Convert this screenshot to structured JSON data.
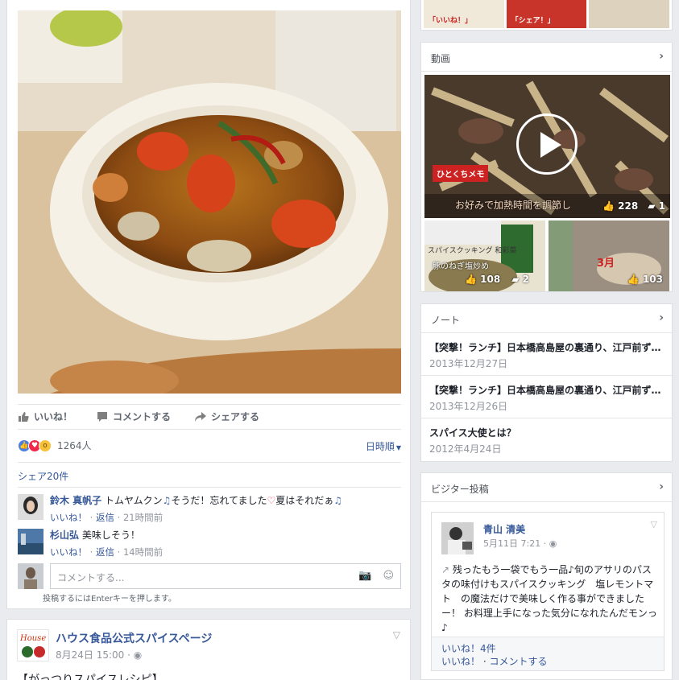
{
  "post_actions": {
    "like": "いいね！",
    "comment": "コメントする",
    "share": "シェアする"
  },
  "reactions": {
    "count": "1264人",
    "sort": "日時順"
  },
  "shares": "シェア20件",
  "comments": [
    {
      "name": "鈴木 真帆子",
      "text_before": "トムヤムクン",
      "text_mid": "そうだ！忘れてました",
      "text_after": "夏はそれだぁ",
      "like": "いいね！",
      "reply": "返信",
      "time": "21時間前"
    },
    {
      "name": "杉山弘",
      "text": "美味しそう！",
      "like": "いいね！",
      "reply": "返信",
      "time": "14時間前"
    }
  ],
  "compose": {
    "placeholder": "コメントする...",
    "hint": "投稿するにはEnterキーを押します。"
  },
  "next_post": {
    "page_name": "ハウス食品公式スパイスページ",
    "date": "8月24日 15:00",
    "text": "【がっつりスパイスレシピ】"
  },
  "top_thumbs": {
    "caption1": "「いいね！」",
    "caption2": "「シェア！」"
  },
  "videos": {
    "title": "動画",
    "main": {
      "logo": "ひとくちメモ",
      "caption": "お好みで加熱時間を調節し",
      "likes": "228",
      "comments": "1"
    },
    "small1": {
      "title": "スパイスクッキング 和彩菜",
      "dish": "豚のねぎ塩炒め",
      "likes": "108",
      "comments": "2"
    },
    "small2": {
      "month": "3月",
      "likes": "103"
    }
  },
  "notes": {
    "title": "ノート",
    "items": [
      {
        "title": "【突撃！ランチ】日本橋高島屋の裏通り、江戸前ず…",
        "date": "2013年12月27日"
      },
      {
        "title": "【突撃！ランチ】日本橋高島屋の裏通り、江戸前ず…",
        "date": "2013年12月26日"
      },
      {
        "title": "スパイス大使とは？",
        "date": "2012年4月24日"
      }
    ]
  },
  "visitor_posts": {
    "title": "ビジター投稿",
    "post": {
      "name": "青山 清美",
      "date": "5月11日 7:21",
      "text": "残ったもう一袋でもう一品♪旬のアサリのパスタの味付けもスパイスクッキング　塩レモントマト　の魔法だけで美味しく作る事ができましたー！ お料理上手になった気分になれたんだモンっ♪",
      "likes": "いいね！4件",
      "like_action": "いいね！",
      "comment_action": "コメントする"
    }
  },
  "colors": {
    "link": "#365899",
    "background": "#e9ebee",
    "meta": "#90949c"
  }
}
